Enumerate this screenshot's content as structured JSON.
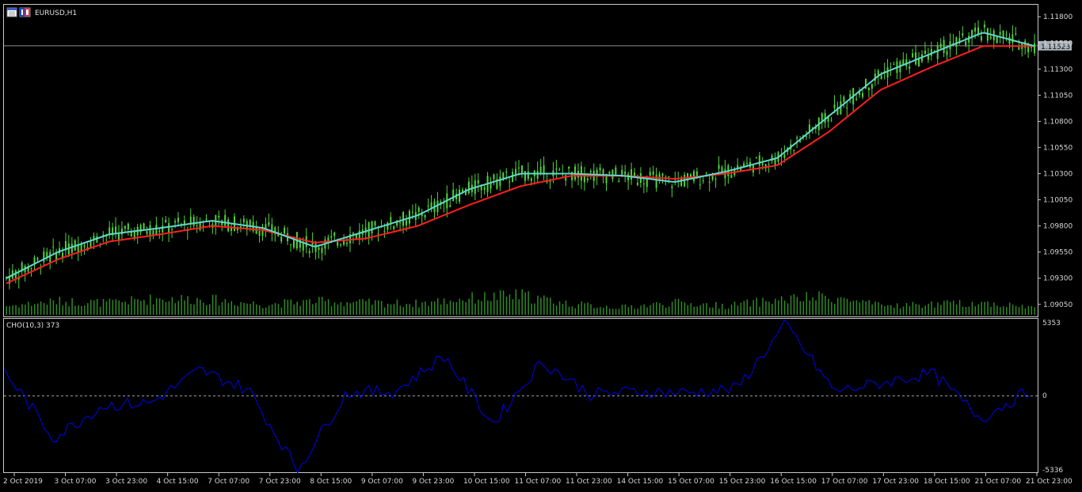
{
  "window": {
    "symbol_title": "EURUSD,H1",
    "current_price_label": "1.11523"
  },
  "colors": {
    "background": "#000000",
    "candle": "#4fd43a",
    "volume": "#2e8b24",
    "ma_fast": "#62d6d0",
    "ma_slow": "#ff1e1e",
    "cho_line": "#0000ee",
    "grid_frame": "#c8c8c8",
    "price_badge": "#a7b0b8"
  },
  "icons": [
    "window-menu-icon",
    "chart-type-icon"
  ],
  "price_axis": {
    "min": 1.0895,
    "max": 1.119,
    "ticks": [
      "1.11800",
      "1.11550",
      "1.11300",
      "1.11050",
      "1.10800",
      "1.10550",
      "1.10300",
      "1.10050",
      "1.09800",
      "1.09550",
      "1.09300",
      "1.09050"
    ],
    "tick_values": [
      1.118,
      1.1155,
      1.113,
      1.1105,
      1.108,
      1.1055,
      1.103,
      1.1005,
      1.098,
      1.0955,
      1.093,
      1.0905
    ],
    "current_price": 1.11523
  },
  "indicator": {
    "label": "CHO(10,3) 373",
    "axis_max_label": "5353",
    "axis_zero_label": "0",
    "axis_min_label": "-5336",
    "max": 5353,
    "min": -5336
  },
  "time_axis": {
    "labels": [
      "2 Oct 2019",
      "3 Oct 07:00",
      "3 Oct 23:00",
      "4 Oct 15:00",
      "7 Oct 07:00",
      "7 Oct 23:00",
      "8 Oct 15:00",
      "9 Oct 07:00",
      "9 Oct 23:00",
      "10 Oct 15:00",
      "11 Oct 07:00",
      "11 Oct 23:00",
      "14 Oct 15:00",
      "15 Oct 07:00",
      "15 Oct 23:00",
      "16 Oct 15:00",
      "17 Oct 07:00",
      "17 Oct 23:00",
      "18 Oct 15:00",
      "21 Oct 07:00",
      "21 Oct 23:00"
    ]
  },
  "chart_data": {
    "type": "line",
    "symbol": "EURUSD",
    "timeframe": "H1",
    "x": [
      "2 Oct 2019",
      "3 Oct 07:00",
      "3 Oct 23:00",
      "4 Oct 15:00",
      "7 Oct 07:00",
      "7 Oct 23:00",
      "8 Oct 15:00",
      "9 Oct 07:00",
      "9 Oct 23:00",
      "10 Oct 15:00",
      "11 Oct 07:00",
      "11 Oct 23:00",
      "14 Oct 15:00",
      "15 Oct 07:00",
      "15 Oct 23:00",
      "16 Oct 15:00",
      "17 Oct 07:00",
      "17 Oct 23:00",
      "18 Oct 15:00",
      "21 Oct 07:00",
      "21 Oct 23:00"
    ],
    "series": [
      {
        "values": [
          1.093,
          1.0955,
          1.0972,
          1.0978,
          1.0985,
          1.0978,
          1.096,
          1.0975,
          1.099,
          1.1015,
          1.103,
          1.103,
          1.1028,
          1.1022,
          1.1032,
          1.1045,
          1.1085,
          1.1125,
          1.1145,
          1.1165,
          1.1152
        ]
      },
      {
        "values": [
          1.0925,
          1.0948,
          1.0965,
          1.0972,
          1.098,
          1.0976,
          1.0964,
          1.0968,
          1.098,
          1.1,
          1.1018,
          1.1028,
          1.1028,
          1.1025,
          1.103,
          1.1038,
          1.107,
          1.111,
          1.1132,
          1.1152,
          1.1152
        ]
      }
    ],
    "volumes": [
      12,
      18,
      16,
      22,
      20,
      14,
      18,
      16,
      15,
      22,
      26,
      14,
      10,
      16,
      12,
      20,
      24,
      12,
      14,
      16,
      10
    ],
    "cho": [
      1700,
      -3000,
      -700,
      -500,
      1800,
      400,
      -5200,
      200,
      300,
      2800,
      -2000,
      2400,
      100,
      300,
      200,
      500,
      5000,
      300,
      900,
      1600,
      -1600,
      373
    ],
    "ylim": [
      1.0895,
      1.119
    ],
    "cho_range": [
      -5336,
      5353
    ]
  }
}
